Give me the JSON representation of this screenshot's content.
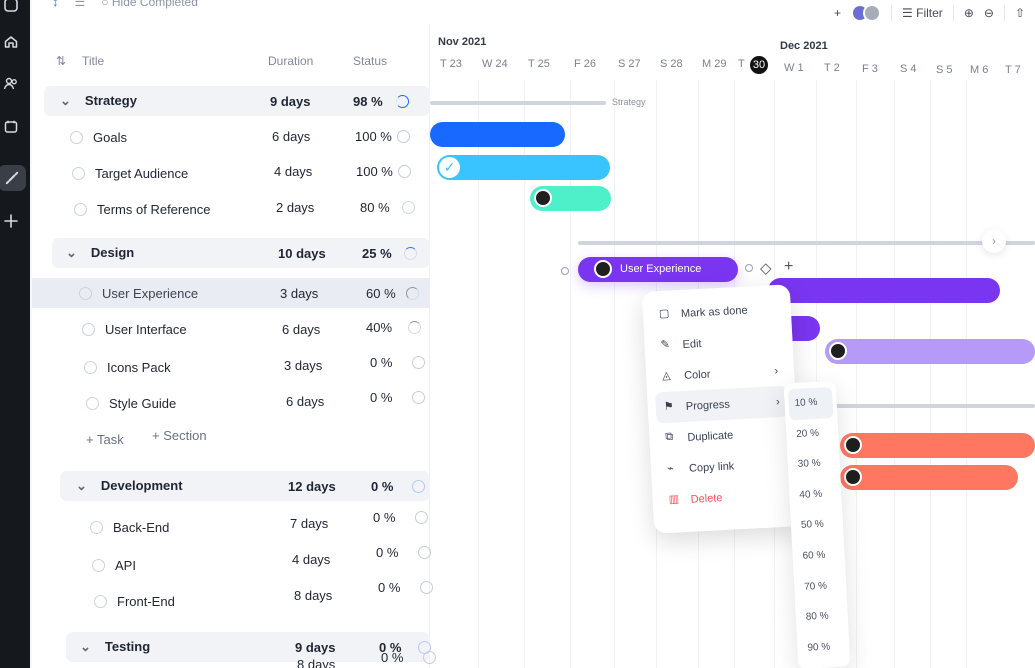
{
  "topbar": {
    "hide_completed_label": "Hide Completed",
    "filter_label": "Filter"
  },
  "table_headers": {
    "title": "Title",
    "duration": "Duration",
    "status": "Status"
  },
  "rows": [
    {
      "kind": "section",
      "name": "Strategy",
      "duration": "9 days",
      "status": "98 %",
      "progress": 0.98
    },
    {
      "kind": "task",
      "name": "Goals",
      "duration": "6 days",
      "status": "100 %",
      "progress": 1
    },
    {
      "kind": "task",
      "name": "Target Audience",
      "duration": "4 days",
      "status": "100 %",
      "progress": 1
    },
    {
      "kind": "task",
      "name": "Terms of Reference",
      "duration": "2 days",
      "status": "80 %",
      "progress": 0.8
    },
    {
      "kind": "section",
      "name": "Design",
      "duration": "10 days",
      "status": "25 %",
      "progress": 0.25
    },
    {
      "kind": "task",
      "name": "User Experience",
      "duration": "3 days",
      "status": "60 %",
      "progress": 0.6,
      "selected": true
    },
    {
      "kind": "task",
      "name": "User Interface",
      "duration": "6 days",
      "status": "40%",
      "progress": 0.4
    },
    {
      "kind": "task",
      "name": "Icons Pack",
      "duration": "3 days",
      "status": "0 %",
      "progress": 0
    },
    {
      "kind": "task",
      "name": "Style Guide",
      "duration": "6 days",
      "status": "0 %",
      "progress": 0
    },
    {
      "kind": "section",
      "name": "Development",
      "duration": "12 days",
      "status": "0 %",
      "progress": 0
    },
    {
      "kind": "task",
      "name": "Back-End",
      "duration": "7 days",
      "status": "0 %",
      "progress": 0
    },
    {
      "kind": "task",
      "name": "API",
      "duration": "4 days",
      "status": "0 %",
      "progress": 0
    },
    {
      "kind": "task",
      "name": "Front-End",
      "duration": "8 days",
      "status": "0 %",
      "progress": 0
    },
    {
      "kind": "section",
      "name": "Testing",
      "duration": "9 days",
      "status": "0 %",
      "progress": 0
    },
    {
      "kind": "task",
      "name": "",
      "duration": "8 days",
      "status": "0 %",
      "progress": 0
    }
  ],
  "add_actions": {
    "task": "Task",
    "section": "Section"
  },
  "timeline": {
    "months": [
      "Nov 2021",
      "Dec 2021"
    ],
    "days": [
      "T 23",
      "W 24",
      "T 25",
      "F 26",
      "S 27",
      "S 28",
      "M 29",
      "T",
      "30",
      "W 1",
      "T 2",
      "F 3",
      "S 4",
      "S 5",
      "M 6",
      "T 7"
    ],
    "strategy_bar_label": "Strategy",
    "selected_bar_label": "User Experience"
  },
  "context_menu": {
    "items": [
      "Mark as done",
      "Edit",
      "Color",
      "Progress",
      "Duplicate",
      "Copy link",
      "Delete"
    ]
  },
  "progress_submenu": {
    "options": [
      "10 %",
      "20 %",
      "30 %",
      "40 %",
      "50 %",
      "60 %",
      "70 %",
      "80 %",
      "90 %"
    ]
  },
  "colors": {
    "blue": "#1769ff",
    "cyan": "#39c4ff",
    "mint": "#4ef0c9",
    "purple": "#7a35f1",
    "lilac": "#b59af8",
    "coral": "#ff7760"
  },
  "icons": {
    "home": "home-icon",
    "users": "users-icon",
    "calendar": "calendar-icon",
    "link": "link-icon",
    "plus": "plus-icon",
    "filter": "filter-icon",
    "zoom_in": "zoom-in-icon",
    "zoom_out": "zoom-out-icon",
    "share": "share-icon"
  }
}
